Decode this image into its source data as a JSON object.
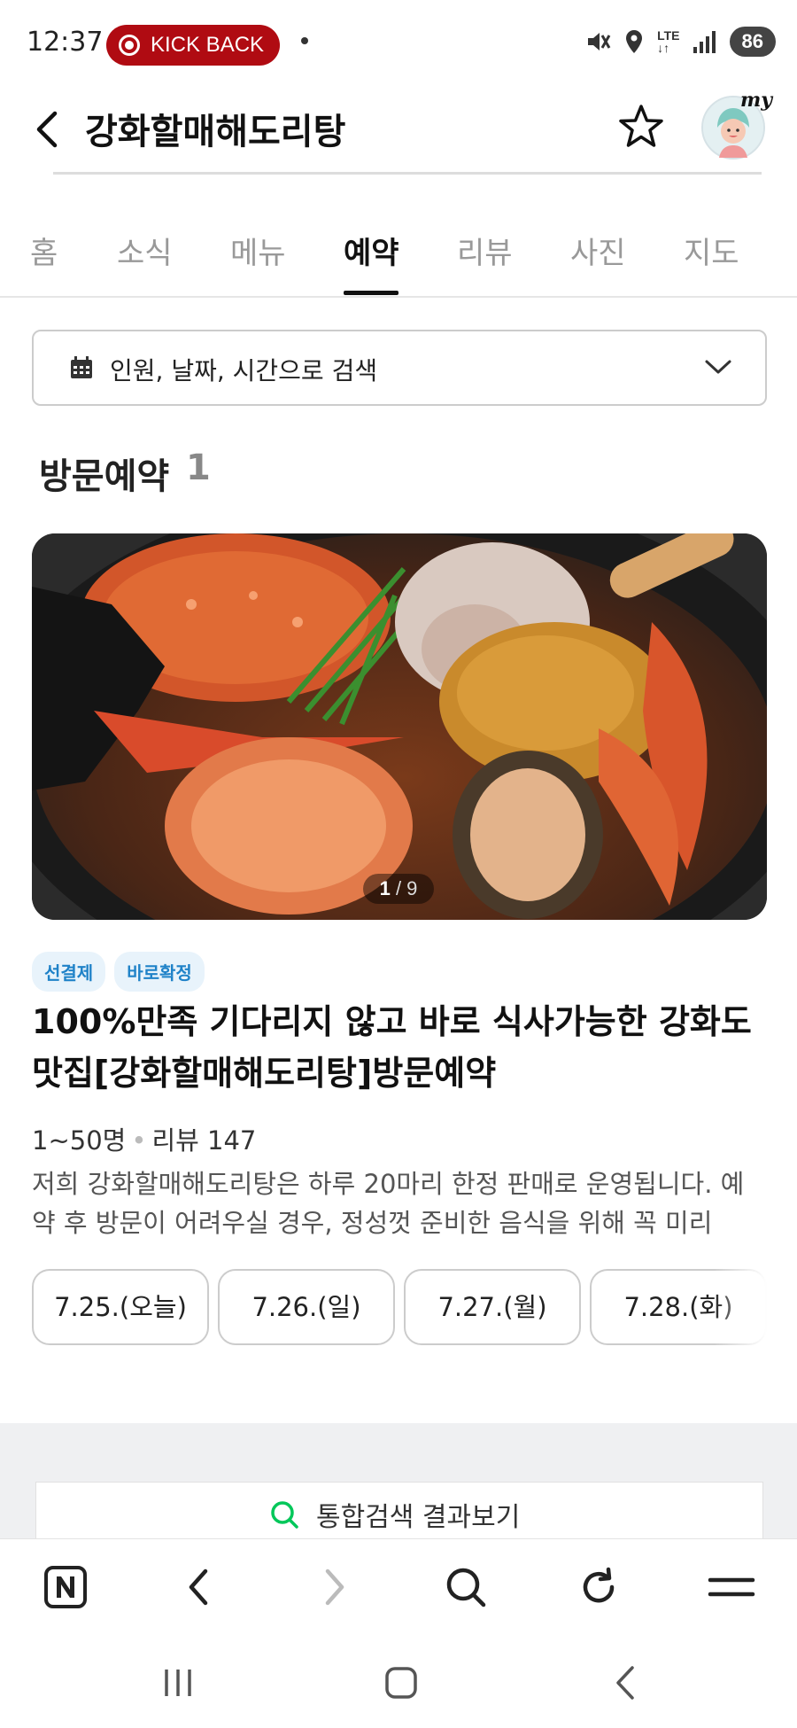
{
  "status_bar": {
    "time": "12:37",
    "kickback_label": "KICK BACK",
    "network": "LTE",
    "battery": "86"
  },
  "header": {
    "title": "강화할매해도리탕",
    "my_label": "my"
  },
  "tabs": [
    {
      "label": "홈",
      "active": false
    },
    {
      "label": "소식",
      "active": false
    },
    {
      "label": "메뉴",
      "active": false
    },
    {
      "label": "예약",
      "active": true
    },
    {
      "label": "리뷰",
      "active": false
    },
    {
      "label": "사진",
      "active": false
    },
    {
      "label": "지도",
      "active": false
    }
  ],
  "search": {
    "label": "인원, 날짜, 시간으로 검색"
  },
  "section": {
    "title": "방문예약",
    "count": "1"
  },
  "offer": {
    "photo_counter_current": "1",
    "photo_counter_total": "/ 9",
    "badges": [
      "선결제",
      "바로확정"
    ],
    "title": "100%만족 기다리지 않고 바로 식사가능한 강화도 맛집[강화할매해도리탕]방문예약",
    "capacity": "1~50명",
    "review_label": "리뷰 147",
    "description": "저희 강화할매해도리탕은 하루 20마리 한정 판매로 운영됩니다. 예약 후 방문이 어려우실 경우, 정성껏 준비한 음식을 위해 꼭 미리 연...",
    "dates": [
      "7.25.(오늘)",
      "7.26.(일)",
      "7.27.(월)",
      "7.28.(화)"
    ]
  },
  "integrated_search": {
    "label": "통합검색 결과보기"
  },
  "colors": {
    "kickback_red": "#b00b12",
    "badge_blue": "#1f82c8",
    "badge_bg": "#e8f3fb",
    "search_green": "#03c75a"
  }
}
